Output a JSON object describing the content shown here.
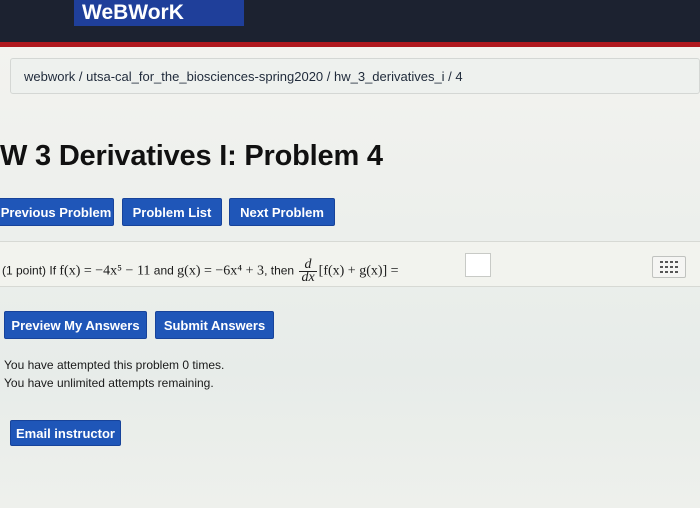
{
  "header": {
    "brand": "WeBWorK"
  },
  "breadcrumb": {
    "text": "webwork / utsa-cal_for_the_biosciences-spring2020 / hw_3_derivatives_i / 4"
  },
  "page": {
    "title": "W 3 Derivatives I: Problem 4"
  },
  "nav": {
    "previous_label": "Previous Problem",
    "list_label": "Problem List",
    "next_label": "Next Problem"
  },
  "problem": {
    "points": "(1 point)",
    "if_text": "If",
    "f_def": "f(x) = −4x⁵ − 11",
    "and_text": "and",
    "g_def": "g(x) = −6x⁴ + 3",
    "then_text": ", then",
    "d_num": "d",
    "d_den": "dx",
    "bracket_expr": "[f(x) + g(x)] =",
    "answer_value": ""
  },
  "actions": {
    "preview_label": "Preview My Answers",
    "submit_label": "Submit Answers"
  },
  "status": {
    "attempts": "You have attempted this problem 0 times.",
    "remaining": "You have unlimited attempts remaining."
  },
  "footer": {
    "email_label": "Email instructor"
  },
  "colors": {
    "accent": "#1f56b8",
    "header_bg": "#1c2230",
    "brand_bg": "#1f3f9a",
    "header_rule": "#b0191f"
  },
  "icons": {
    "answer_helper": "grid-icon"
  }
}
